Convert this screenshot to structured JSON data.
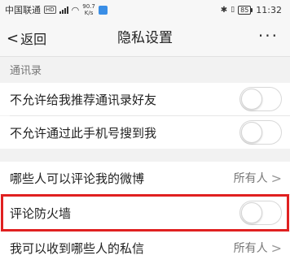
{
  "status_bar": {
    "carrier": "中国联通",
    "hd_badge": "HD",
    "net_speed_value": "90.7",
    "net_speed_unit": "K/s",
    "battery": "85",
    "time": "11:32"
  },
  "nav": {
    "back_label": "返回",
    "title": "隐私设置",
    "more": "···"
  },
  "sections": [
    {
      "header": "通讯录",
      "rows": [
        {
          "label": "不允许给我推荐通讯录好友",
          "type": "toggle",
          "on": false
        },
        {
          "label": "不允许通过此手机号搜到我",
          "type": "toggle",
          "on": false
        }
      ]
    },
    {
      "header": "",
      "rows": [
        {
          "label": "哪些人可以评论我的微博",
          "type": "value",
          "value": "所有人"
        },
        {
          "label": "评论防火墙",
          "type": "toggle",
          "on": false,
          "highlighted": true
        },
        {
          "label": "我可以收到哪些人的私信",
          "type": "value",
          "value": "所有人"
        }
      ]
    }
  ],
  "colors": {
    "highlight": "#e02020",
    "background": "#f2f2f2",
    "row_background": "#ffffff"
  }
}
